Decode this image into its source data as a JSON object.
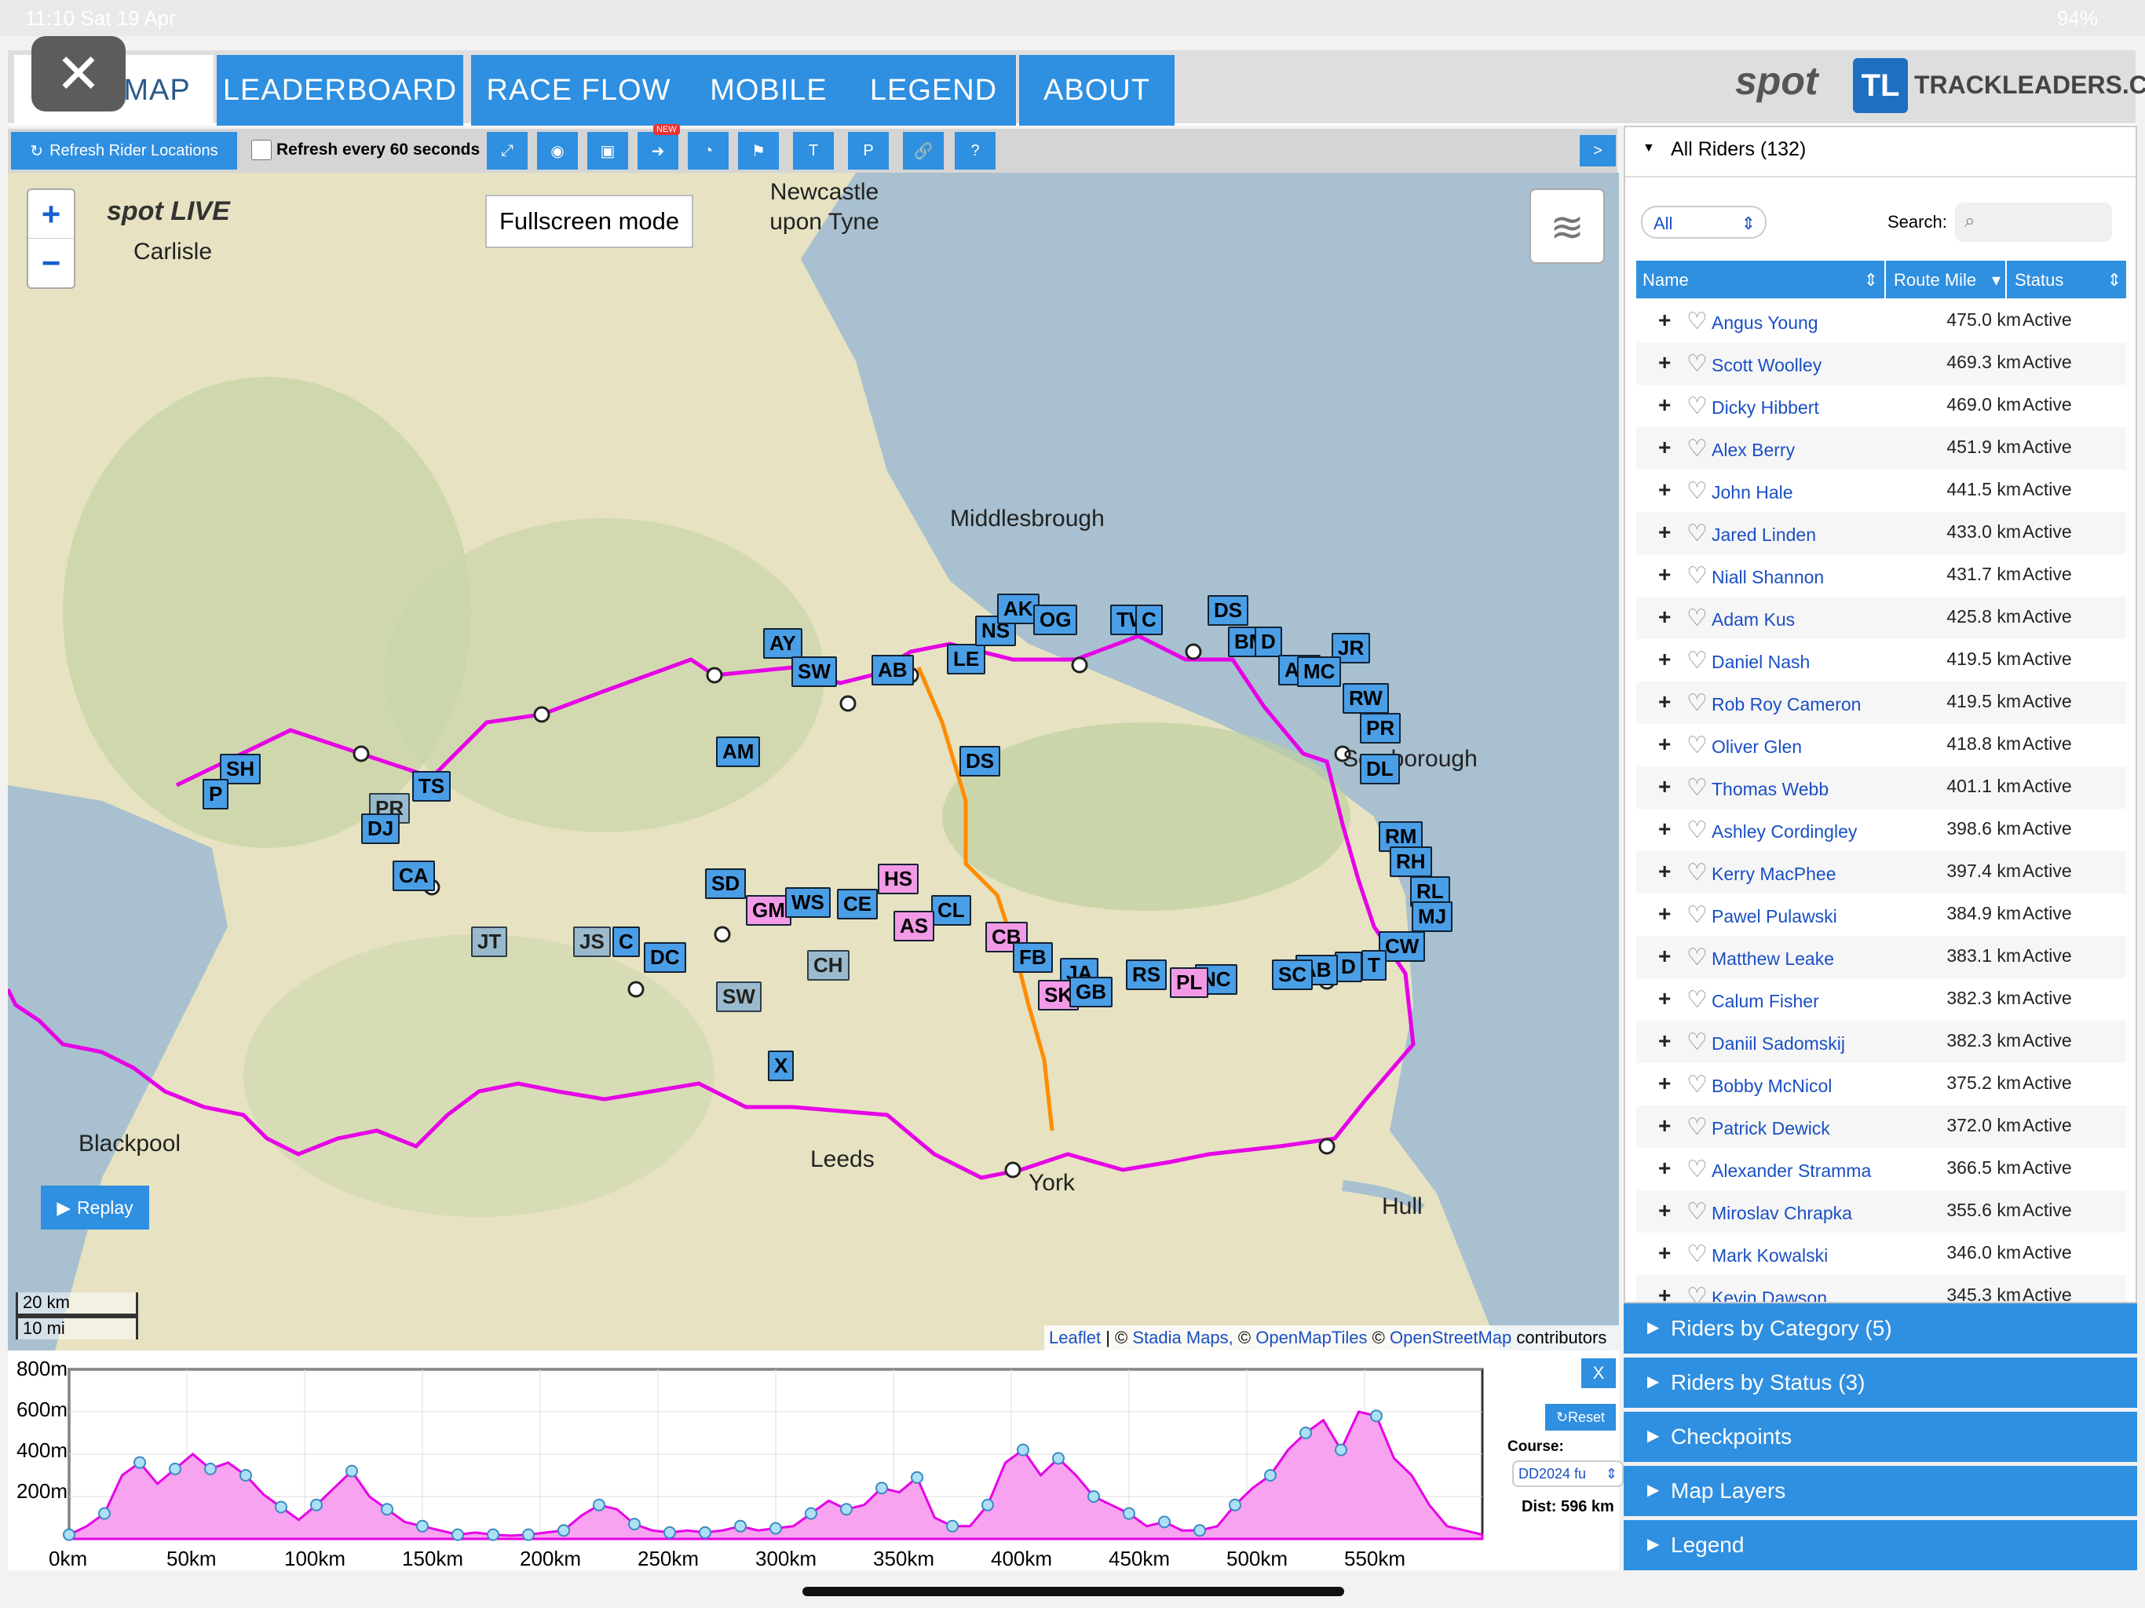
{
  "statusbar": {
    "time": "11:10 Sat 19 Apr",
    "battery": "94%"
  },
  "tabs": [
    {
      "label": "MAP"
    },
    {
      "label": "LEADERBOARD"
    },
    {
      "label": "RACE FLOW"
    },
    {
      "label": "MOBILE"
    },
    {
      "label": "LEGEND"
    },
    {
      "label": "ABOUT"
    }
  ],
  "new_badge": "NEW",
  "brand": {
    "spot": "spot",
    "site": "TRACKLEADERS.COM"
  },
  "toolbar": {
    "refresh_label": "Refresh Rider Locations",
    "auto_refresh_label": "Refresh every 60 seconds",
    "auto_refresh_checked": false,
    "t_label": "T",
    "p_label": "P",
    "help_label": "?",
    "expand_label": ">"
  },
  "map": {
    "tooltip": "Fullscreen mode",
    "zoom_in": "+",
    "zoom_out": "−",
    "replay_label": "Replay",
    "scale_km": "20 km",
    "scale_mi": "10 mi",
    "spot_logo": "spot LIVE",
    "attribution": {
      "leaflet": "Leaflet",
      "sep1": "|",
      "copy1": "©",
      "stadia": "Stadia Maps,",
      "copy2": "©",
      "omt": "OpenMapTiles",
      "copy3": "©",
      "osm": "OpenStreetMap",
      "contrib": "contributors"
    },
    "cities": [
      "Newcastle upon Tyne",
      "Carlisle",
      "Middlesbrough",
      "Scarborough",
      "York",
      "Leeds",
      "Blackpool",
      "Hull"
    ],
    "rider_labels": [
      "SH",
      "P",
      "PR",
      "DJ",
      "TS",
      "CA",
      "JT",
      "JS",
      "C",
      "DC",
      "SW",
      "CH",
      "X",
      "SD",
      "GM",
      "WS",
      "CE",
      "HS",
      "CL",
      "AS",
      "AM",
      "AY",
      "SW",
      "AB",
      "LE",
      "NS",
      "AK",
      "OG",
      "TW",
      "C",
      "DS",
      "BM",
      "D",
      "JR",
      "AA",
      "MC",
      "RW",
      "PR",
      "DL",
      "RM",
      "RH",
      "RL",
      "MJ",
      "CW",
      "D",
      "T",
      "AB",
      "SC",
      "NC",
      "PL",
      "RS",
      "JA",
      "CB",
      "FB",
      "SK",
      "GB",
      "DS"
    ],
    "pink_labels": [
      "HS",
      "AS",
      "SK",
      "GM",
      "PL",
      "CB"
    ]
  },
  "elevation": {
    "close_label": "X",
    "reset_label": "Reset",
    "course_label": "Course:",
    "course_value": "DD2024 fu",
    "dist_label": "Dist: 596 km",
    "y_ticks": [
      "800m",
      "600m",
      "400m",
      "200m"
    ],
    "x_ticks": [
      "0km",
      "50km",
      "100km",
      "150km",
      "200km",
      "250km",
      "300km",
      "350km",
      "400km",
      "450km",
      "500km",
      "550km"
    ]
  },
  "panel": {
    "title": "All Riders (132)",
    "filter": "All",
    "search_label": "Search:",
    "search_placeholder": "",
    "cols": [
      "Name",
      "Route Mile",
      "Status"
    ],
    "riders": [
      {
        "name": "Angus Young",
        "mile": "475.0 km",
        "status": "Active"
      },
      {
        "name": "Scott Woolley",
        "mile": "469.3 km",
        "status": "Active"
      },
      {
        "name": "Dicky Hibbert",
        "mile": "469.0 km",
        "status": "Active"
      },
      {
        "name": "Alex Berry",
        "mile": "451.9 km",
        "status": "Active"
      },
      {
        "name": "John Hale",
        "mile": "441.5 km",
        "status": "Active"
      },
      {
        "name": "Jared Linden",
        "mile": "433.0 km",
        "status": "Active"
      },
      {
        "name": "Niall Shannon",
        "mile": "431.7 km",
        "status": "Active"
      },
      {
        "name": "Adam Kus",
        "mile": "425.8 km",
        "status": "Active"
      },
      {
        "name": "Daniel Nash",
        "mile": "419.5 km",
        "status": "Active"
      },
      {
        "name": "Rob Roy Cameron",
        "mile": "419.5 km",
        "status": "Active"
      },
      {
        "name": "Oliver Glen",
        "mile": "418.8 km",
        "status": "Active"
      },
      {
        "name": "Thomas Webb",
        "mile": "401.1 km",
        "status": "Active"
      },
      {
        "name": "Ashley Cordingley",
        "mile": "398.6 km",
        "status": "Active"
      },
      {
        "name": "Kerry MacPhee",
        "mile": "397.4 km",
        "status": "Active"
      },
      {
        "name": "Pawel Pulawski",
        "mile": "384.9 km",
        "status": "Active"
      },
      {
        "name": "Matthew Leake",
        "mile": "383.1 km",
        "status": "Active"
      },
      {
        "name": "Calum Fisher",
        "mile": "382.3 km",
        "status": "Active"
      },
      {
        "name": "Daniil Sadomskij",
        "mile": "382.3 km",
        "status": "Active"
      },
      {
        "name": "Bobby McNicol",
        "mile": "375.2 km",
        "status": "Active"
      },
      {
        "name": "Patrick Dewick",
        "mile": "372.0 km",
        "status": "Active"
      },
      {
        "name": "Alexander Stramma",
        "mile": "366.5 km",
        "status": "Active"
      },
      {
        "name": "Miroslav Chrapka",
        "mile": "355.6 km",
        "status": "Active"
      },
      {
        "name": "Mark Kowalski",
        "mile": "346.0 km",
        "status": "Active"
      },
      {
        "name": "Kevin Dawson",
        "mile": "345.3 km",
        "status": "Active"
      }
    ]
  },
  "accordions": [
    "Riders by Category (5)",
    "Riders by Status (3)",
    "Checkpoints",
    "Map Layers",
    "Legend"
  ],
  "colors": {
    "accent": "#2f8fe0",
    "route": "#e600e6",
    "alt_route": "#ff8c00",
    "rider": "#4a9ee6",
    "rider_pink": "#f29ae6"
  }
}
